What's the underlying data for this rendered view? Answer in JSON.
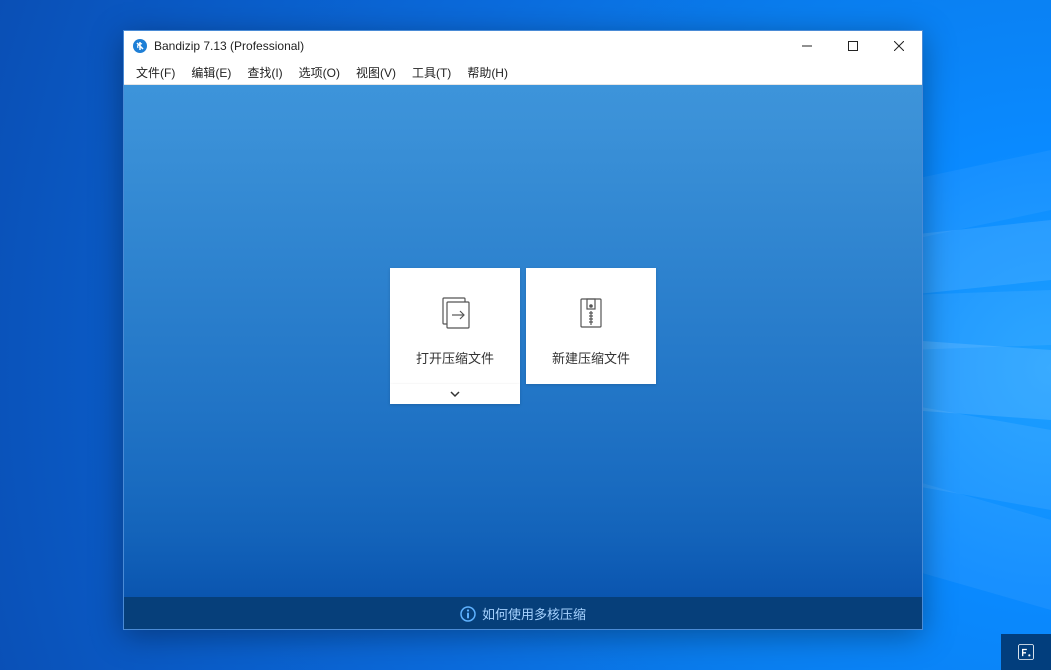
{
  "window": {
    "title": "Bandizip 7.13 (Professional)"
  },
  "menu": {
    "items": [
      "文件(F)",
      "编辑(E)",
      "查找(I)",
      "选项(O)",
      "视图(V)",
      "工具(T)",
      "帮助(H)"
    ]
  },
  "actions": {
    "open_archive": "打开压缩文件",
    "new_archive": "新建压缩文件"
  },
  "status": {
    "tip": "如何使用多核压缩"
  },
  "icons": {
    "app": "bandizip-icon",
    "info": "info-icon"
  }
}
